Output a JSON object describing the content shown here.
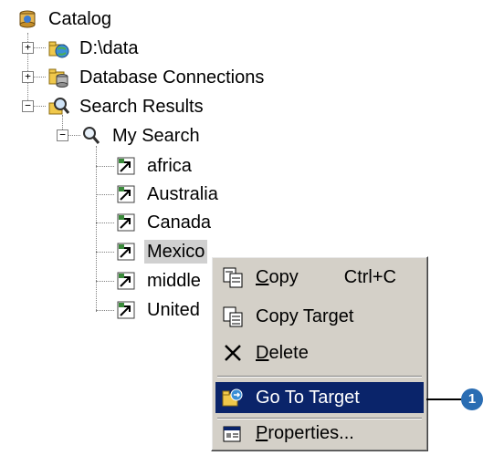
{
  "tree": {
    "root": {
      "label": "Catalog",
      "icon": "catalog-icon"
    },
    "items": [
      {
        "label": "D:\\data",
        "icon": "folder-globe-icon"
      },
      {
        "label": "Database Connections",
        "icon": "database-connections-icon"
      },
      {
        "label": "Search Results",
        "icon": "search-results-icon"
      },
      {
        "label": "My Search",
        "icon": "magnifier-icon"
      }
    ],
    "results": [
      "africa",
      "Australia",
      "Canada",
      "Mexico",
      "middle",
      "United"
    ],
    "selected": "Mexico"
  },
  "context_menu": {
    "items": [
      {
        "label": "Copy",
        "underline": "C",
        "rest": "opy",
        "shortcut": "Ctrl+C",
        "icon": "copy-icon"
      },
      {
        "label": "Copy Target",
        "icon": "copy-target-icon"
      },
      {
        "label": "Delete",
        "underline": "D",
        "rest": "elete",
        "icon": "delete-icon"
      },
      {
        "label": "Go To Target",
        "icon": "go-to-target-icon",
        "highlighted": true
      },
      {
        "label": "Properties...",
        "underline": "P",
        "rest": "roperties...",
        "icon": "properties-icon"
      }
    ]
  },
  "callout": {
    "number": "1",
    "color": "#2a6db3"
  },
  "colors": {
    "menu_bg": "#d4d0c8",
    "highlight": "#0a246a",
    "selection": "#d0d0d0"
  }
}
